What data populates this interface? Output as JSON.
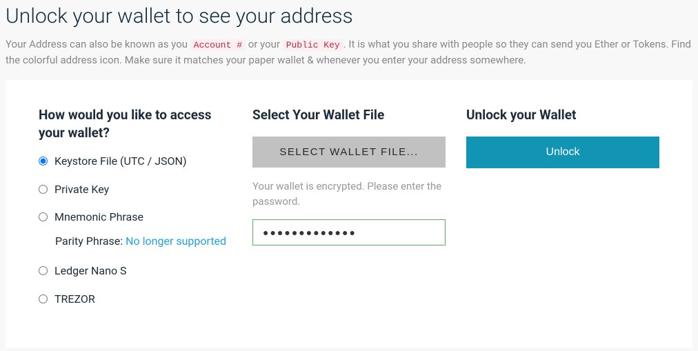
{
  "header": {
    "title": "Unlock your wallet to see your address",
    "subtitle_part1": "Your Address can also be known as you ",
    "code1": "Account #",
    "subtitle_part2": " or your ",
    "code2": "Public Key",
    "subtitle_part3": ". It is what you share with people so they can send you Ether or Tokens. Find the colorful address icon. Make sure it matches your paper wallet & whenever you enter your address somewhere."
  },
  "access": {
    "heading": "How would you like to access your wallet?",
    "options": {
      "keystore": "Keystore File (UTC / JSON)",
      "private_key": "Private Key",
      "mnemonic": "Mnemonic Phrase",
      "ledger": "Ledger Nano S",
      "trezor": "TREZOR"
    },
    "parity_prefix": "Parity Phrase: ",
    "parity_link": "No longer supported"
  },
  "file": {
    "heading": "Select Your Wallet File",
    "button": "SELECT WALLET FILE...",
    "help": "Your wallet is encrypted. Please enter the password.",
    "password_value": "●●●●●●●●●●●●●"
  },
  "unlock": {
    "heading": "Unlock your Wallet",
    "button": "Unlock"
  }
}
